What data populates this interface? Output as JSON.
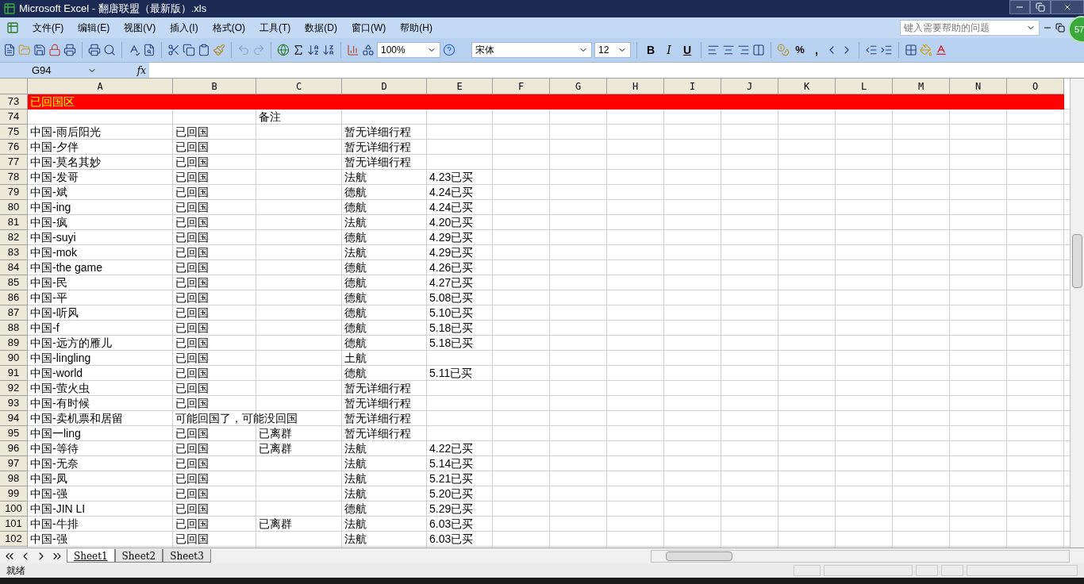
{
  "window": {
    "title": "Microsoft Excel - 翻唐联盟（最新版）.xls",
    "badge": "57"
  },
  "menu": [
    "文件(F)",
    "编辑(E)",
    "视图(V)",
    "插入(I)",
    "格式(O)",
    "工具(T)",
    "数据(D)",
    "窗口(W)",
    "帮助(H)"
  ],
  "help_search": {
    "placeholder": "键入需要帮助的问题"
  },
  "toolbar": {
    "zoom": "100%",
    "font": "宋体",
    "size": "12",
    "format_buttons": [
      {
        "kind": "bold",
        "label": "B"
      },
      {
        "kind": "italic",
        "label": "I"
      },
      {
        "kind": "underline",
        "label": "U"
      }
    ],
    "percent": "%",
    "comma": ","
  },
  "formula_bar": {
    "name_box": "G94",
    "fx": "fx"
  },
  "columns": [
    "A",
    "B",
    "C",
    "D",
    "E",
    "F",
    "G",
    "H",
    "I",
    "J",
    "K",
    "L",
    "M",
    "N",
    "O"
  ],
  "rows": [
    {
      "number": "73",
      "kind": "section",
      "cells": {
        "A": "已回国区"
      }
    },
    {
      "number": "74",
      "kind": "data",
      "cells": {
        "C": "备注"
      }
    },
    {
      "number": "75",
      "kind": "data",
      "cells": {
        "A": "中国-雨后阳光",
        "B": "已回国",
        "D": "暂无详细行程"
      }
    },
    {
      "number": "76",
      "kind": "data",
      "cells": {
        "A": "中国-夕伴",
        "B": "已回国",
        "D": "暂无详细行程"
      }
    },
    {
      "number": "77",
      "kind": "data",
      "cells": {
        "A": "中国-莫名其妙",
        "B": "已回国",
        "D": "暂无详细行程"
      }
    },
    {
      "number": "78",
      "kind": "data",
      "cells": {
        "A": "中国-发哥",
        "B": "已回国",
        "D": "法航",
        "E": "4.23已买"
      }
    },
    {
      "number": "79",
      "kind": "data",
      "cells": {
        "A": "中国-斌",
        "B": "已回国",
        "D": "德航",
        "E": "4.24已买"
      }
    },
    {
      "number": "80",
      "kind": "data",
      "cells": {
        "A": "中国-ing",
        "B": "已回国",
        "D": "德航",
        "E": "4.24已买"
      }
    },
    {
      "number": "81",
      "kind": "data",
      "cells": {
        "A": "中国-疯",
        "B": "已回国",
        "D": "法航",
        "E": "4.20已买"
      }
    },
    {
      "number": "82",
      "kind": "data",
      "cells": {
        "A": "中国-suyi",
        "B": "已回国",
        "D": "德航",
        "E": "4.29已买"
      }
    },
    {
      "number": "83",
      "kind": "data",
      "cells": {
        "A": "中国-mok",
        "B": "已回国",
        "D": "法航",
        "E": "4.29已买"
      }
    },
    {
      "number": "84",
      "kind": "data",
      "cells": {
        "A": "中国-the game",
        "B": "已回国",
        "D": "德航",
        "E": "4.26已买"
      }
    },
    {
      "number": "85",
      "kind": "data",
      "cells": {
        "A": "中国-民",
        "B": "已回国",
        "D": "德航",
        "E": "4.27已买"
      }
    },
    {
      "number": "86",
      "kind": "data",
      "cells": {
        "A": "中国-平",
        "B": "已回国",
        "D": "德航",
        "E": "5.08已买"
      }
    },
    {
      "number": "87",
      "kind": "data",
      "cells": {
        "A": "中国-听风",
        "B": "已回国",
        "D": "德航",
        "E": "5.10已买"
      }
    },
    {
      "number": "88",
      "kind": "data",
      "cells": {
        "A": "中国-f",
        "B": "已回国",
        "D": "德航",
        "E": "5.18已买"
      }
    },
    {
      "number": "89",
      "kind": "data",
      "cells": {
        "A": "中国-远方的雁儿",
        "B": "已回国",
        "D": "德航",
        "E": "5.18已买"
      }
    },
    {
      "number": "90",
      "kind": "data",
      "cells": {
        "A": "中国-lingling",
        "B": "已回国",
        "D": "土航"
      }
    },
    {
      "number": "91",
      "kind": "data",
      "cells": {
        "A": "中国-world",
        "B": "已回国",
        "D": "德航",
        "E": "5.11已买"
      }
    },
    {
      "number": "92",
      "kind": "data",
      "cells": {
        "A": "中国-萤火虫",
        "B": "已回国",
        "D": "暂无详细行程"
      }
    },
    {
      "number": "93",
      "kind": "data",
      "cells": {
        "A": "中国-有时候",
        "B": "已回国",
        "D": "暂无详细行程"
      }
    },
    {
      "number": "94",
      "kind": "data",
      "cells": {
        "A": "中国-卖机票和居留",
        "B": "可能回国了，可能没回国",
        "D": "暂无详细行程"
      }
    },
    {
      "number": "95",
      "kind": "data",
      "cells": {
        "A": "中国一ling",
        "B": "已回国",
        "C": "已离群",
        "D": "暂无详细行程"
      }
    },
    {
      "number": "96",
      "kind": "data",
      "cells": {
        "A": "中国-等待",
        "B": "已回国",
        "C": "已离群",
        "D": "法航",
        "E": "4.22已买"
      }
    },
    {
      "number": "97",
      "kind": "data",
      "cells": {
        "A": "中国-无奈",
        "B": "已回国",
        "D": "法航",
        "E": "5.14已买"
      }
    },
    {
      "number": "98",
      "kind": "data",
      "cells": {
        "A": "中国-凤",
        "B": "已回国",
        "D": "法航",
        "E": "5.21已买"
      }
    },
    {
      "number": "99",
      "kind": "data",
      "cells": {
        "A": "中国-强",
        "B": "已回国",
        "D": "法航",
        "E": "5.20已买"
      }
    },
    {
      "number": "100",
      "kind": "data",
      "cells": {
        "A": "中国-JIN LI",
        "B": "已回国",
        "D": "德航",
        "E": "5.29已买"
      }
    },
    {
      "number": "101",
      "kind": "data",
      "cells": {
        "A": "中国-牛排",
        "B": "已回国",
        "C": "已离群",
        "D": "法航",
        "E": "6.03已买"
      }
    },
    {
      "number": "102",
      "kind": "data",
      "cells": {
        "A": "中国-强",
        "B": "已回国",
        "D": "法航",
        "E": "6.03已买"
      }
    }
  ],
  "sheet_tabs": [
    {
      "label": "Sheet1",
      "selected": true
    },
    {
      "label": "Sheet2",
      "selected": false
    },
    {
      "label": "Sheet3",
      "selected": false
    }
  ],
  "status_bar": {
    "text": "就绪"
  }
}
